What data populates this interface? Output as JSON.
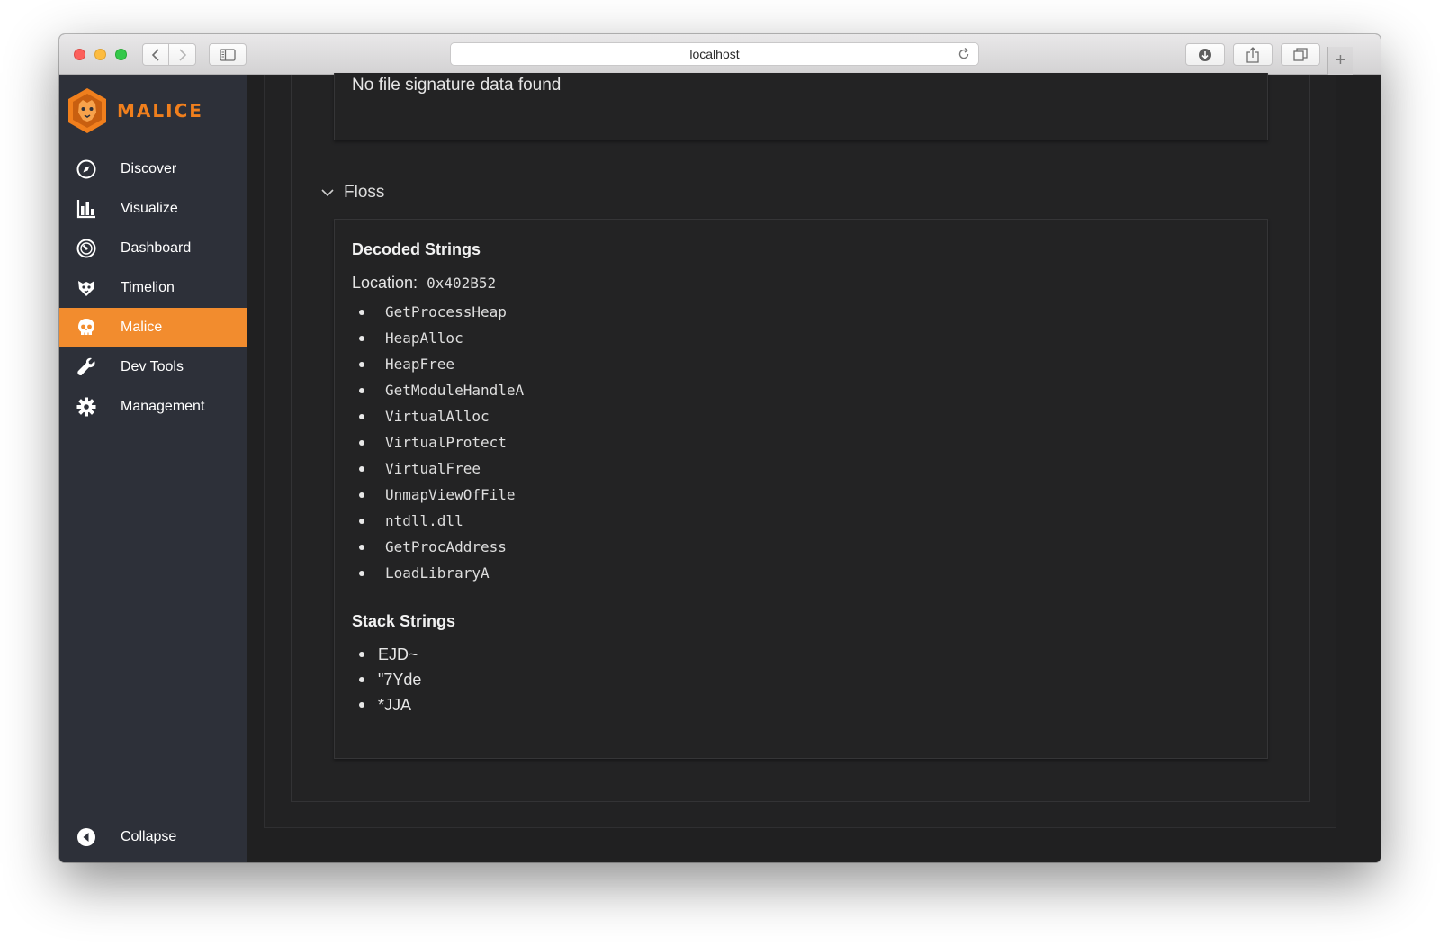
{
  "browser": {
    "url": "localhost"
  },
  "sidebar": {
    "brand": "MALICE",
    "items": [
      {
        "label": "Discover",
        "icon": "compass-icon"
      },
      {
        "label": "Visualize",
        "icon": "bar-chart-icon"
      },
      {
        "label": "Dashboard",
        "icon": "gauge-icon"
      },
      {
        "label": "Timelion",
        "icon": "timelion-icon"
      },
      {
        "label": "Malice",
        "icon": "skull-icon",
        "active": true
      },
      {
        "label": "Dev Tools",
        "icon": "wrench-icon"
      },
      {
        "label": "Management",
        "icon": "gear-icon"
      }
    ],
    "collapse_label": "Collapse",
    "accent_color": "#f28c2e",
    "brand_color": "#f07f1d"
  },
  "content": {
    "file_signature_message": "No file signature data found",
    "floss_section_title": "Floss",
    "decoded_strings_heading": "Decoded Strings",
    "location_label": "Location:",
    "location_value": "0x402B52",
    "decoded_strings": [
      "GetProcessHeap",
      "HeapAlloc",
      "HeapFree",
      "GetModuleHandleA",
      "VirtualAlloc",
      "VirtualProtect",
      "VirtualFree",
      "UnmapViewOfFile",
      "ntdll.dll",
      "GetProcAddress",
      "LoadLibraryA"
    ],
    "stack_strings_heading": "Stack Strings",
    "stack_strings": [
      "EJD~",
      "\"7Yde",
      "*JJA"
    ]
  }
}
